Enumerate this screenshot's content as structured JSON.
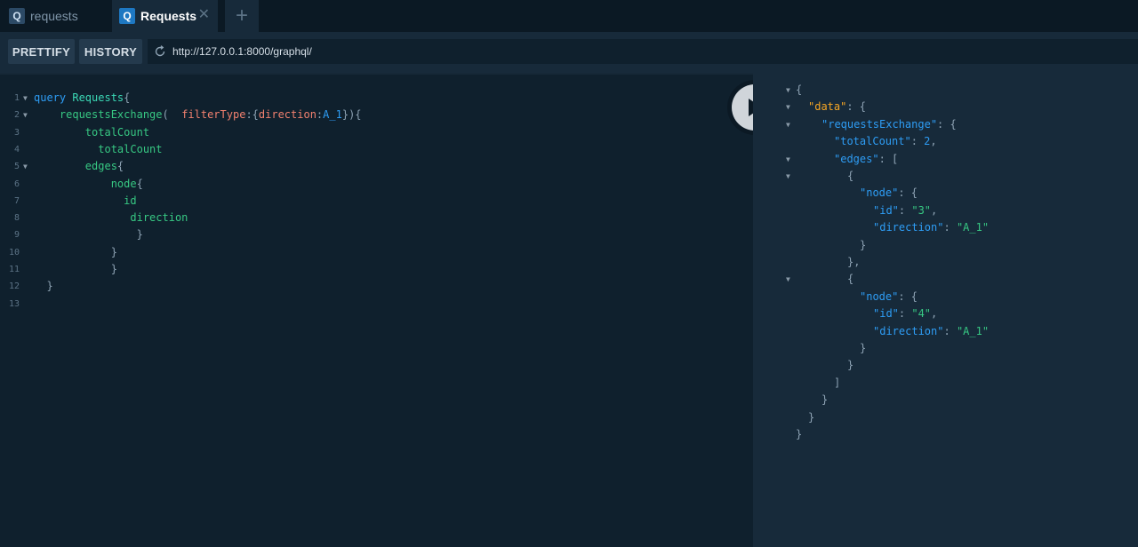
{
  "tabs": [
    {
      "icon": "Q",
      "label": "requests"
    },
    {
      "icon": "Q",
      "label": "Requests",
      "close": "✕"
    }
  ],
  "add_tab": "+",
  "toolbar": {
    "prettify": "PRETTIFY",
    "history": "HISTORY",
    "endpoint": "http://127.0.0.1:8000/graphql/"
  },
  "editor": {
    "line_numbers": [
      "1",
      "2",
      "3",
      "4",
      "5",
      "6",
      "7",
      "8",
      "9",
      "10",
      "11",
      "12",
      "13"
    ],
    "lines": [
      [
        {
          "t": "query",
          "c": "kw"
        },
        {
          "t": " ",
          "c": "punct"
        },
        {
          "t": "Requests",
          "c": "def"
        },
        {
          "t": "{",
          "c": "punct"
        }
      ],
      [
        {
          "t": "    ",
          "c": "punct"
        },
        {
          "t": "requestsExchange",
          "c": "fld"
        },
        {
          "t": "(  ",
          "c": "punct"
        },
        {
          "t": "filterType",
          "c": "arg"
        },
        {
          "t": ":{",
          "c": "punct"
        },
        {
          "t": "direction",
          "c": "arg"
        },
        {
          "t": ":",
          "c": "punct"
        },
        {
          "t": "A_1",
          "c": "val"
        },
        {
          "t": "}){",
          "c": "punct"
        }
      ],
      [
        {
          "t": "        ",
          "c": "punct"
        },
        {
          "t": "totalCount",
          "c": "fld"
        }
      ],
      [
        {
          "t": "          ",
          "c": "punct"
        },
        {
          "t": "totalCount",
          "c": "fld"
        }
      ],
      [
        {
          "t": "        ",
          "c": "punct"
        },
        {
          "t": "edges",
          "c": "fld"
        },
        {
          "t": "{",
          "c": "punct"
        }
      ],
      [
        {
          "t": "            ",
          "c": "punct"
        },
        {
          "t": "node",
          "c": "fld"
        },
        {
          "t": "{",
          "c": "punct"
        }
      ],
      [
        {
          "t": "              ",
          "c": "punct"
        },
        {
          "t": "id",
          "c": "fld"
        }
      ],
      [
        {
          "t": "               ",
          "c": "punct"
        },
        {
          "t": "direction",
          "c": "fld"
        }
      ],
      [
        {
          "t": "                ",
          "c": "punct"
        },
        {
          "t": "}",
          "c": "punct"
        }
      ],
      [
        {
          "t": "            ",
          "c": "punct"
        },
        {
          "t": "}",
          "c": "punct"
        }
      ],
      [
        {
          "t": "            ",
          "c": "punct"
        },
        {
          "t": "}",
          "c": "punct"
        }
      ],
      [
        {
          "t": "  ",
          "c": "punct"
        },
        {
          "t": "}",
          "c": "punct"
        }
      ],
      []
    ]
  },
  "result": {
    "lines": [
      [
        {
          "t": "{",
          "c": "rp"
        }
      ],
      [
        {
          "t": "\"data\"",
          "c": "key-top"
        },
        {
          "t": ": {",
          "c": "rp"
        }
      ],
      [
        {
          "t": "\"requestsExchange\"",
          "c": "key"
        },
        {
          "t": ": {",
          "c": "rp"
        }
      ],
      [
        {
          "t": "\"totalCount\"",
          "c": "key"
        },
        {
          "t": ": ",
          "c": "rp"
        },
        {
          "t": "2",
          "c": "num"
        },
        {
          "t": ",",
          "c": "rp"
        }
      ],
      [
        {
          "t": "\"edges\"",
          "c": "key"
        },
        {
          "t": ": [",
          "c": "rp"
        }
      ],
      [
        {
          "t": "{",
          "c": "rp"
        }
      ],
      [
        {
          "t": "\"node\"",
          "c": "key"
        },
        {
          "t": ": {",
          "c": "rp"
        }
      ],
      [
        {
          "t": "\"id\"",
          "c": "key"
        },
        {
          "t": ": ",
          "c": "rp"
        },
        {
          "t": "\"3\"",
          "c": "str"
        },
        {
          "t": ",",
          "c": "rp"
        }
      ],
      [
        {
          "t": "\"direction\"",
          "c": "key"
        },
        {
          "t": ": ",
          "c": "rp"
        },
        {
          "t": "\"A_1\"",
          "c": "str"
        }
      ],
      [
        {
          "t": "}",
          "c": "rp"
        }
      ],
      [
        {
          "t": "},",
          "c": "rp"
        }
      ],
      [
        {
          "t": "{",
          "c": "rp"
        }
      ],
      [
        {
          "t": "\"node\"",
          "c": "key"
        },
        {
          "t": ": {",
          "c": "rp"
        }
      ],
      [
        {
          "t": "\"id\"",
          "c": "key"
        },
        {
          "t": ": ",
          "c": "rp"
        },
        {
          "t": "\"4\"",
          "c": "str"
        },
        {
          "t": ",",
          "c": "rp"
        }
      ],
      [
        {
          "t": "\"direction\"",
          "c": "key"
        },
        {
          "t": ": ",
          "c": "rp"
        },
        {
          "t": "\"A_1\"",
          "c": "str"
        }
      ],
      [
        {
          "t": "}",
          "c": "rp"
        }
      ],
      [
        {
          "t": "}",
          "c": "rp"
        }
      ],
      [
        {
          "t": "]",
          "c": "rp"
        }
      ],
      [
        {
          "t": "}",
          "c": "rp"
        }
      ],
      [
        {
          "t": "}",
          "c": "rp"
        }
      ],
      [
        {
          "t": "}",
          "c": "rp"
        }
      ]
    ]
  },
  "icons": {
    "reload": "reload-icon",
    "run": "play-icon",
    "fold": "fold-arrow-icon"
  },
  "colors": {
    "editor_bg": "#0f202d",
    "result_bg": "#172a3a",
    "keyword": "#2e9df5",
    "field": "#37c883",
    "argument": "#f2816f",
    "top_key": "#f5a524"
  }
}
